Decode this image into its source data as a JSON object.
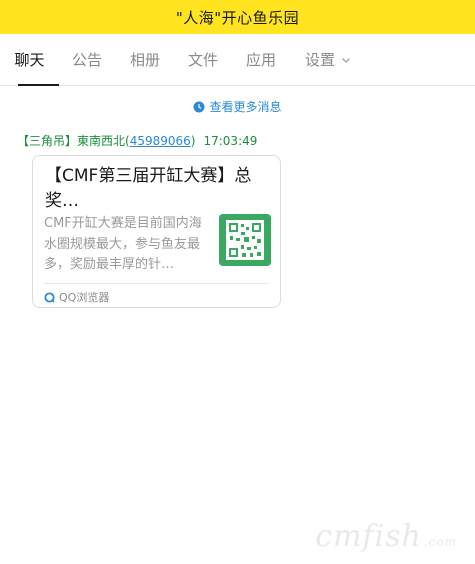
{
  "header": {
    "title": "\"人海\"开心鱼乐园"
  },
  "tabs": [
    {
      "label": "聊天",
      "active": true
    },
    {
      "label": "公告"
    },
    {
      "label": "相册"
    },
    {
      "label": "文件"
    },
    {
      "label": "应用"
    },
    {
      "label": "设置",
      "has_dropdown": true
    }
  ],
  "chat": {
    "more_messages": "查看更多消息",
    "message": {
      "sender_tag": "【三角吊】",
      "sender_name": "東南西北",
      "uid_open": "(",
      "uid": "45989066",
      "uid_close": ")",
      "time": "17:03:49",
      "card": {
        "title": "【CMF第三届开缸大赛】总奖…",
        "description": "CMF开缸大赛是目前国内海水圈规模最大，参与鱼友最多，奖励最丰厚的针…",
        "source": "QQ浏览器"
      }
    }
  },
  "watermark": {
    "brand": "cmfish",
    "suffix": ".com"
  },
  "colors": {
    "header_bg": "#ffe41f",
    "sender_green": "#1b8e3a",
    "link_blue": "#2a8ad8",
    "thumb_green": "#3aa861"
  }
}
